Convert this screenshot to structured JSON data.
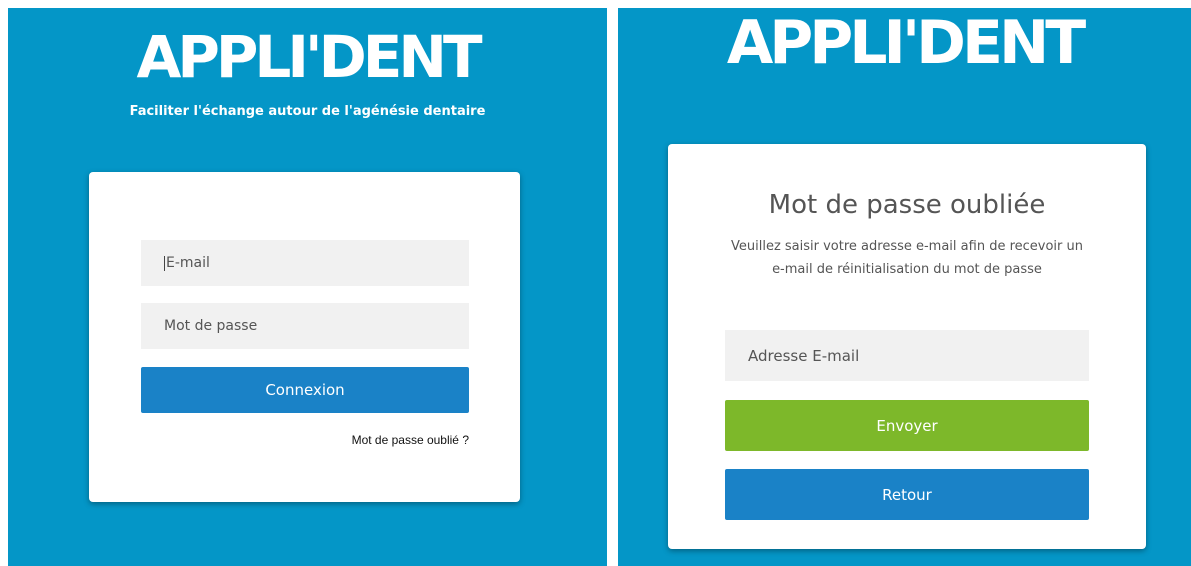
{
  "login_screen": {
    "brand": "APPLI'DENT",
    "tagline": "Faciliter l'échange autour de l'agénésie dentaire",
    "email_placeholder": "E-mail",
    "password_placeholder": "Mot de passe",
    "connexion_label": "Connexion",
    "forgot_link": "Mot de passe oublié ?"
  },
  "forgot_screen": {
    "brand": "APPLI'DENT",
    "title": "Mot de passe oubliée",
    "description": "Veuillez saisir votre adresse e-mail afin de recevoir un e-mail de réinitialisation du mot de passe",
    "email_placeholder": "Adresse E-mail",
    "send_label": "Envoyer",
    "back_label": "Retour"
  },
  "colors": {
    "background": "#0496c7",
    "primary_button": "#1a82c7",
    "send_button": "#7db82a",
    "field": "#f1f1f1"
  }
}
